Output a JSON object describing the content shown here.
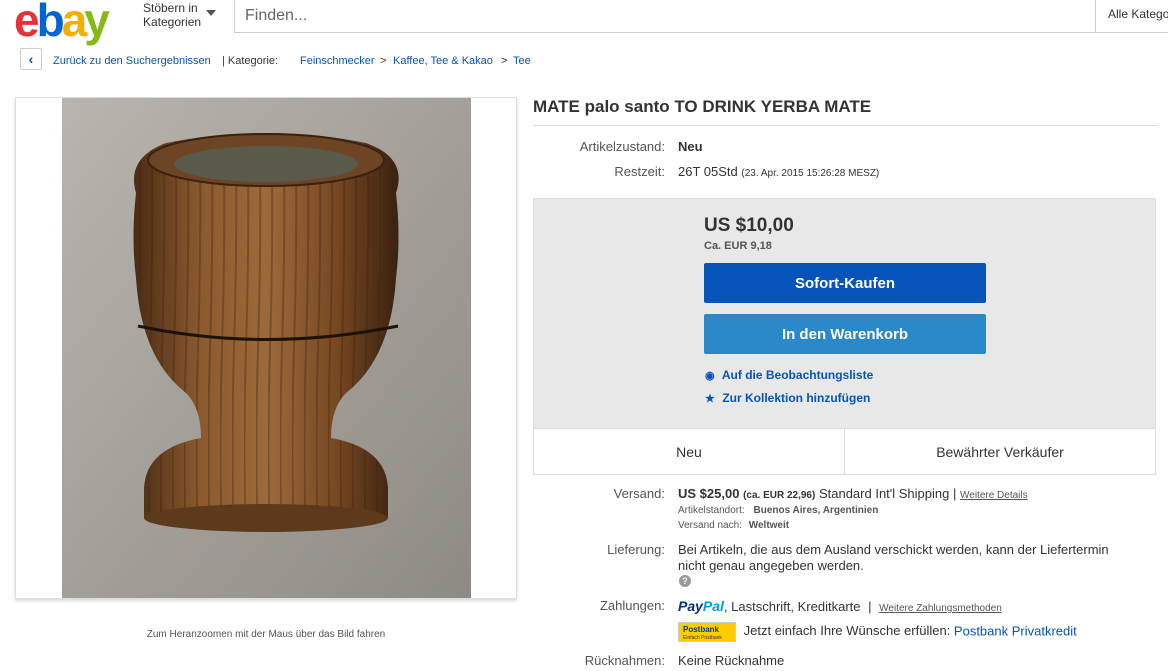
{
  "header": {
    "logo": [
      "e",
      "b",
      "a",
      "y"
    ],
    "browse_label_1": "Stöbern in",
    "browse_label_2": "Kategorien",
    "search_placeholder": "Finden...",
    "category_select": "Alle Katego"
  },
  "breadcrumb": {
    "back": "Zurück zu den Suchergebnissen",
    "category_label": "| Kategorie:",
    "items": [
      "Feinschmecker",
      "Kaffee, Tee & Kakao",
      "Tee"
    ],
    "sep": ">"
  },
  "image": {
    "zoom_hint": "Zum Heranzoomen mit der Maus über das Bild fahren"
  },
  "listing": {
    "title": "MATE palo santo TO DRINK YERBA MATE",
    "condition_label": "Artikelzustand:",
    "condition_value": "Neu",
    "time_label": "Restzeit:",
    "time_value": "26T 05Std",
    "time_end": "(23. Apr. 2015   15:26:28 MESZ)"
  },
  "buybox": {
    "price": "US $10,00",
    "price_eur": "Ca. EUR 9,18",
    "buy_now": "Sofort-Kaufen",
    "add_to_cart": "In den Warenkorb",
    "watchlist": "Auf die Beobachtungsliste",
    "collection": "Zur Kollektion hinzufügen",
    "features": [
      "Neu",
      "Bewährter Verkäufer"
    ]
  },
  "shipping": {
    "label": "Versand:",
    "price": "US $25,00",
    "price_eur": "(ca. EUR 22,96)",
    "method": "Standard Int'l Shipping",
    "pipe": "|",
    "details_link": "Weitere Details",
    "location_label": "Artikelstandort:",
    "location_value": "Buenos Aires, Argentinien",
    "ships_to_label": "Versand nach:",
    "ships_to_value": "Weltweit"
  },
  "delivery": {
    "label": "Lieferung:",
    "text_1": "Bei Artikeln, die aus dem Ausland verschickt werden, kann der Liefertermin",
    "text_2": "nicht genau angegeben werden.",
    "help": "?"
  },
  "payment": {
    "label": "Zahlungen:",
    "paypal_1": "Pay",
    "paypal_2": "Pal",
    "methods": ", Lastschrift, Kreditkarte",
    "pipe": "|",
    "more_link": "Weitere Zahlungsmethoden",
    "postbank_logo": "Postbank",
    "postbank_tag": "Einfach Postbank",
    "postbank_text": "Jetzt einfach Ihre Wünsche erfüllen:",
    "postbank_link": "Postbank Privatkredit"
  },
  "returns": {
    "label": "Rücknahmen:",
    "value": "Keine Rücknahme"
  }
}
